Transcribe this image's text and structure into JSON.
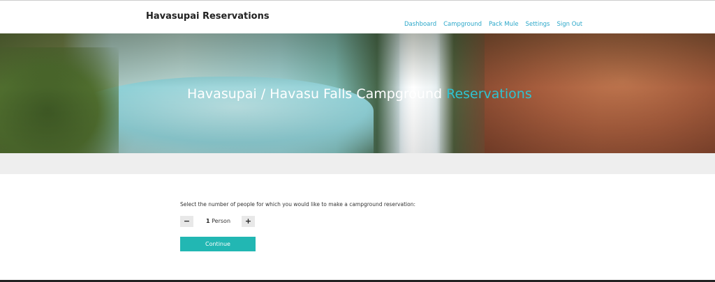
{
  "header": {
    "brand": "Havasupai Reservations",
    "nav": [
      {
        "label": "Dashboard"
      },
      {
        "label": "Campground"
      },
      {
        "label": "Pack Mule"
      },
      {
        "label": "Settings"
      },
      {
        "label": "Sign Out"
      }
    ]
  },
  "hero": {
    "title_main": "Havasupai / Havasu Falls Campground",
    "title_accent": "Reservations"
  },
  "form": {
    "prompt": "Select the number of people for which you would like to make a campground reservation:",
    "minus_label": "−",
    "plus_label": "+",
    "count_value": "1",
    "count_unit": "Person",
    "continue_label": "Continue"
  },
  "colors": {
    "accent": "#2fc3d1",
    "link": "#2aa7c9",
    "button": "#22b7b3"
  }
}
